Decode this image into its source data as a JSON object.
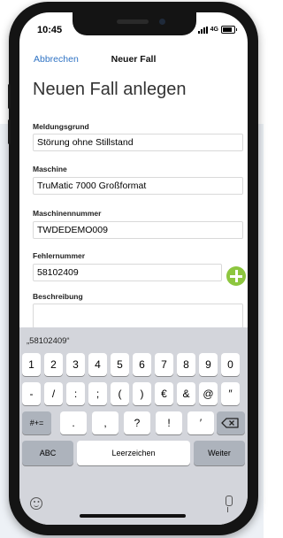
{
  "status_bar": {
    "time": "10:45",
    "network": "4G"
  },
  "nav": {
    "cancel_label": "Abbrechen",
    "title": "Neuer Fall"
  },
  "page_title": "Neuen Fall anlegen",
  "form": {
    "reason_label": "Meldungsgrund",
    "reason_value": "Störung ohne Stillstand",
    "machine_label": "Maschine",
    "machine_value": "TruMatic 7000 Großformat",
    "machine_number_label": "Maschinennummer",
    "machine_number_value": "TWDEDEMO009",
    "error_number_label": "Fehlernummer",
    "error_number_value": "58102409",
    "description_label": "Beschreibung",
    "description_value": ""
  },
  "keyboard": {
    "suggestion": "„58102409“",
    "row1": [
      "1",
      "2",
      "3",
      "4",
      "5",
      "6",
      "7",
      "8",
      "9",
      "0"
    ],
    "row2": [
      "-",
      "/",
      ":",
      ";",
      "(",
      ")",
      "€",
      "&",
      "@",
      "″"
    ],
    "row3_left": "#+=",
    "row3_mid": [
      ".",
      ",",
      "?",
      "!",
      "′"
    ],
    "row4": {
      "abc": "ABC",
      "space": "Leerzeichen",
      "next": "Weiter"
    }
  },
  "icons": {
    "add": "plus-circle-icon",
    "backspace": "backspace-icon",
    "emoji": "emoji-icon",
    "mic": "mic-icon"
  },
  "colors": {
    "accent": "#2f73c4",
    "add_button": "#8dc63f",
    "keyboard_bg": "#d3d5db"
  }
}
